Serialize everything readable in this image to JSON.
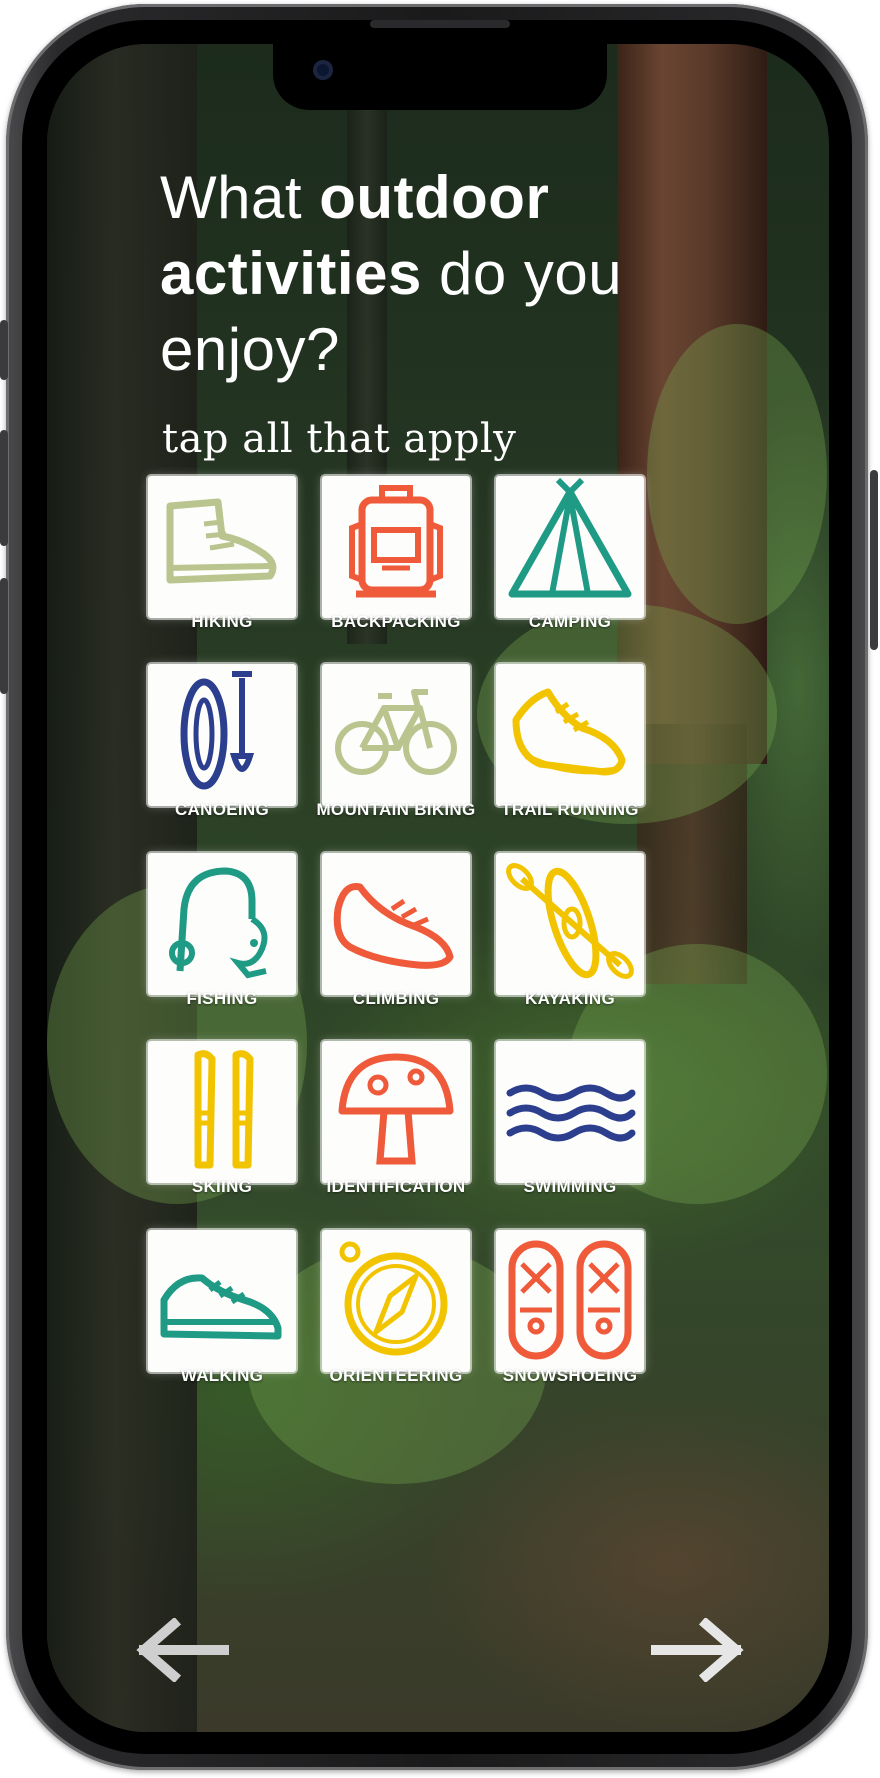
{
  "header": {
    "title_pre": "What ",
    "title_bold1": "outdoor",
    "title_bold2": "activities",
    "title_post": " do you enjoy?",
    "subtitle": "tap all that apply"
  },
  "activities": [
    {
      "label": "HIKING",
      "icon": "hiking-boot-icon",
      "color": "#b9c48e"
    },
    {
      "label": "BACKPACKING",
      "icon": "backpack-icon",
      "color": "#ef5a3a"
    },
    {
      "label": "CAMPING",
      "icon": "tent-icon",
      "color": "#1f9a85"
    },
    {
      "label": "CANOEING",
      "icon": "canoe-paddle-icon",
      "color": "#2b3f8e"
    },
    {
      "label": "MOUNTAIN BIKING",
      "icon": "bicycle-icon",
      "color": "#b9c48e"
    },
    {
      "label": "TRAIL RUNNING",
      "icon": "running-shoe-icon",
      "color": "#f2c400"
    },
    {
      "label": "FISHING",
      "icon": "fishing-rod-icon",
      "color": "#1f9a85"
    },
    {
      "label": "CLIMBING",
      "icon": "climbing-shoe-icon",
      "color": "#ef5a3a"
    },
    {
      "label": "KAYAKING",
      "icon": "kayak-icon",
      "color": "#f2c400"
    },
    {
      "label": "SKIING",
      "icon": "skis-icon",
      "color": "#f2c400"
    },
    {
      "label": "IDENTIFICATION",
      "icon": "mushroom-icon",
      "color": "#ef5a3a"
    },
    {
      "label": "SWIMMING",
      "icon": "waves-icon",
      "color": "#2b3f8e"
    },
    {
      "label": "WALKING",
      "icon": "sneaker-icon",
      "color": "#1f9a85"
    },
    {
      "label": "ORIENTEERING",
      "icon": "compass-icon",
      "color": "#f2c400"
    },
    {
      "label": "SNOWSHOEING",
      "icon": "snowshoes-icon",
      "color": "#ef5a3a"
    }
  ],
  "navigation": {
    "back_icon": "arrow-left-icon",
    "next_icon": "arrow-right-icon",
    "arrow_color": "#cfcfcf"
  }
}
